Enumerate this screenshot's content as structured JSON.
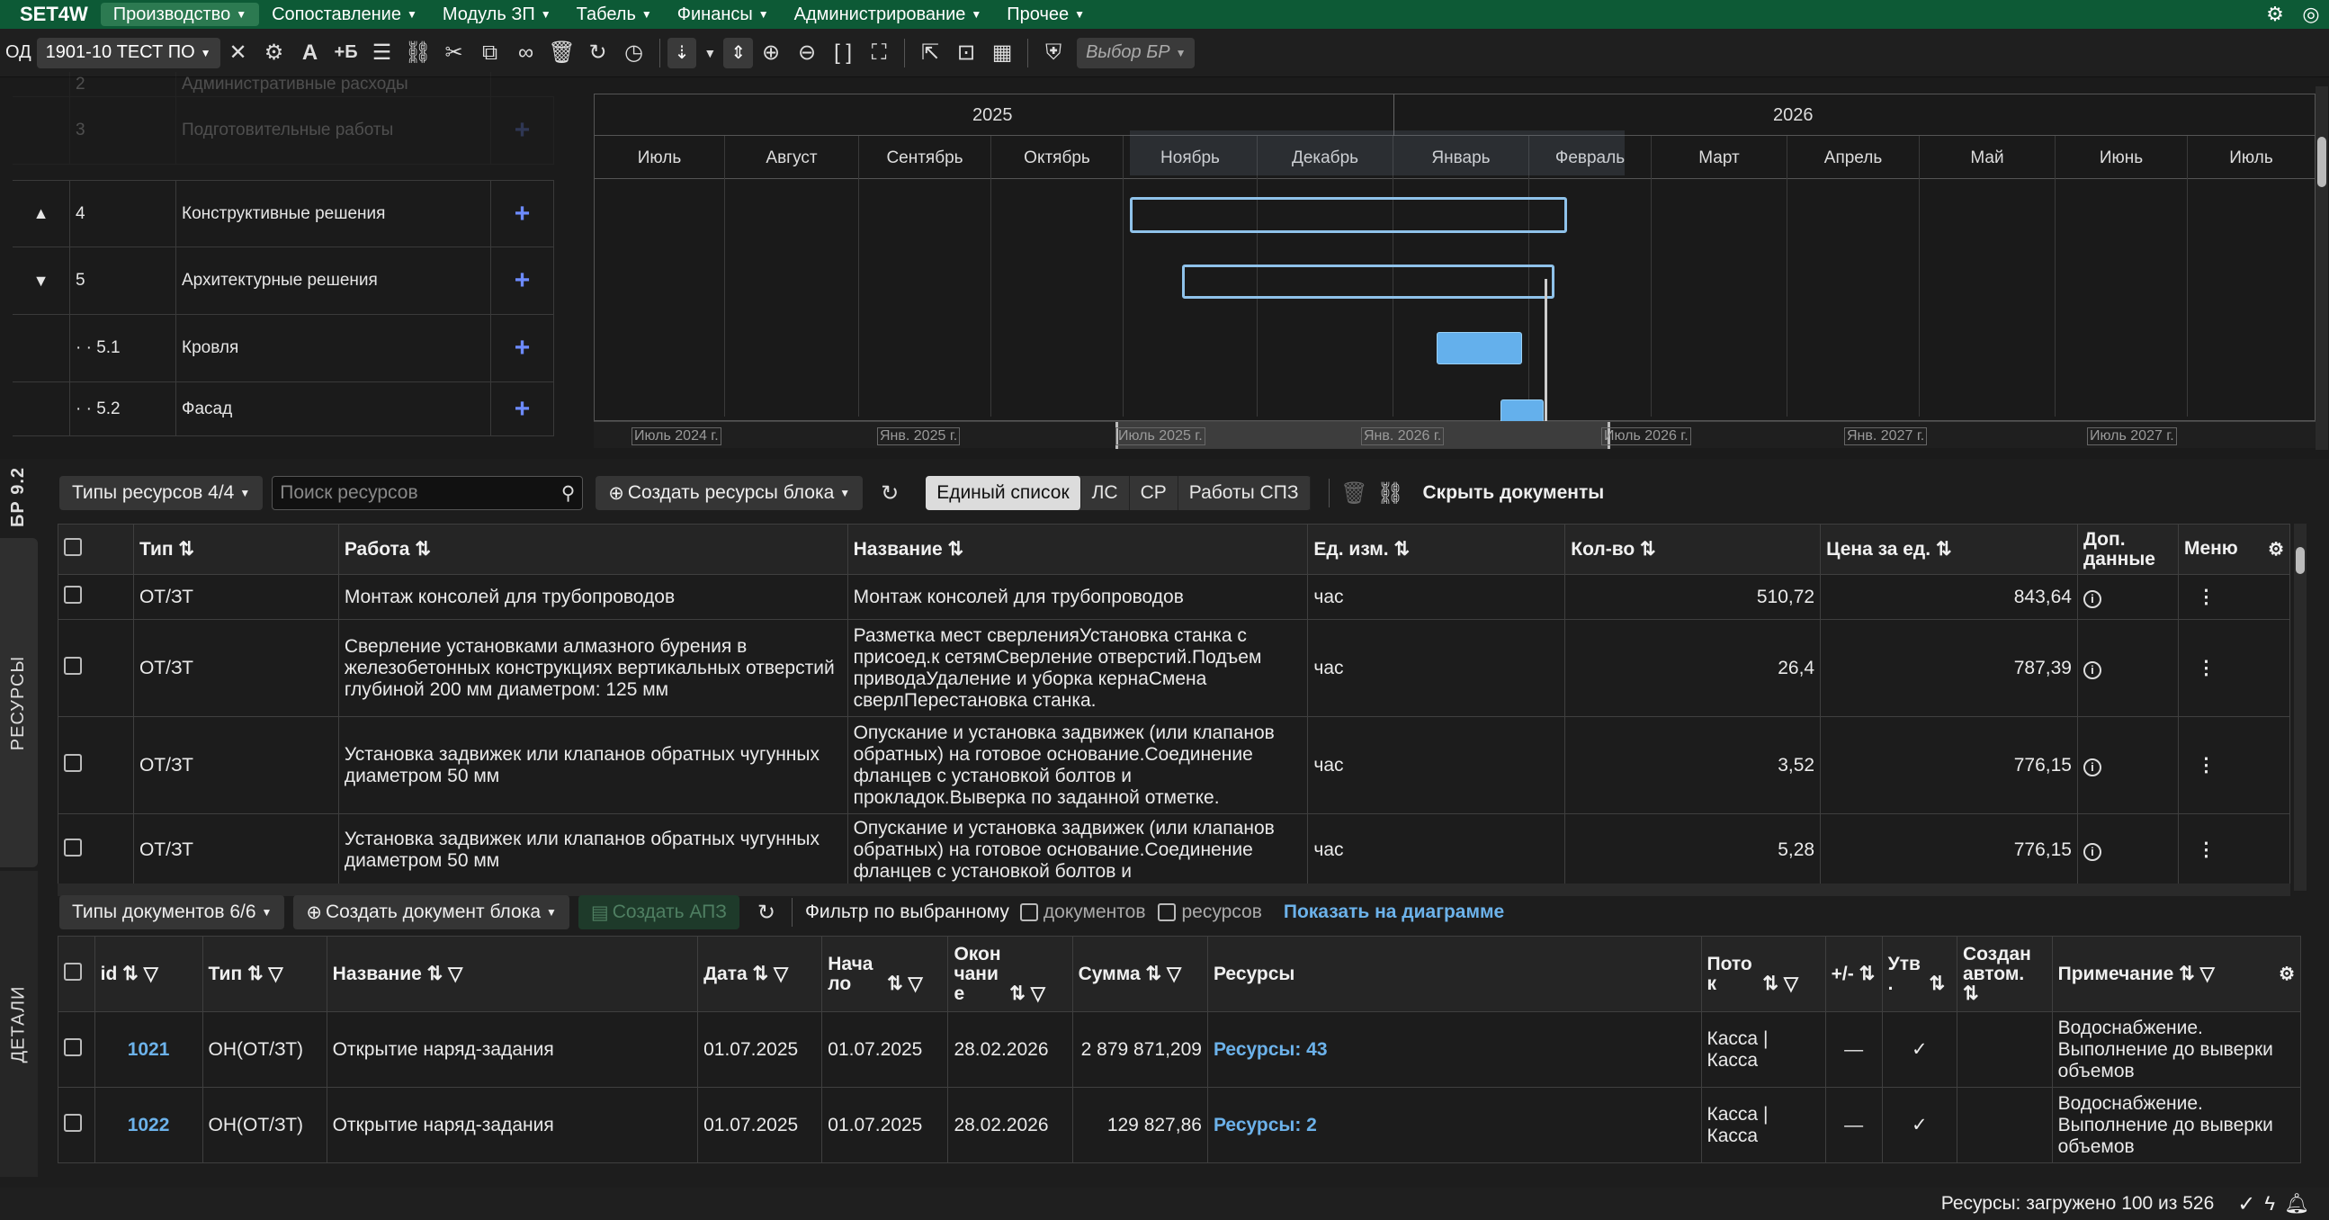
{
  "app": {
    "logo": "SET4W"
  },
  "menu": [
    "Производство",
    "Сопоставление",
    "Модуль ЗП",
    "Табель",
    "Финансы",
    "Администрирование",
    "Прочее"
  ],
  "toolbar": {
    "od_label": "ОД",
    "project": "1901-10 ТЕСТ ПО",
    "select_br": "Выбор БР"
  },
  "gantt": {
    "faded_rows": [
      {
        "num": "2",
        "name": "Административные расходы"
      },
      {
        "num": "3",
        "name": "Подготовительные работы"
      }
    ],
    "rows": [
      {
        "toggle": "▲",
        "num": "4",
        "name": "Конструктивные решения"
      },
      {
        "toggle": "▼",
        "num": "5",
        "name": "Архитектурные решения"
      },
      {
        "toggle": "",
        "num": "· · 5.1",
        "name": "Кровля"
      },
      {
        "toggle": "",
        "num": "· · 5.2",
        "name": "Фасад"
      }
    ],
    "years": [
      "2025",
      "2026"
    ],
    "months": [
      "Июль",
      "Август",
      "Сентябрь",
      "Октябрь",
      "Ноябрь",
      "Декабрь",
      "Январь",
      "Февраль",
      "Март",
      "Апрель",
      "Май",
      "Июнь",
      "Июль"
    ],
    "navigator_labels": [
      "Июль 2024 г.",
      "Янв. 2025 г.",
      "Июль 2025 г.",
      "Янв. 2026 г.",
      "Июль 2026 г.",
      "Янв. 2027 г.",
      "Июль 2027 г."
    ]
  },
  "side_tabs": {
    "br": "БР 9.2",
    "resources": "РЕСУРСЫ",
    "details": "ДЕТАЛИ"
  },
  "resources": {
    "types_btn": "Типы ресурсов 4/4",
    "search_placeholder": "Поиск ресурсов",
    "create_btn": "Создать ресурсы блока",
    "views": [
      "Единый список",
      "ЛС",
      "СР",
      "Работы СПЗ"
    ],
    "hide_docs": "Скрыть документы",
    "headers": {
      "type": "Тип",
      "work": "Работа",
      "name": "Название",
      "unit": "Ед. изм.",
      "qty": "Кол-во",
      "price": "Цена за ед.",
      "extra": "Доп. данные",
      "menu": "Меню"
    },
    "rows": [
      {
        "type": "ОТ/ЗТ",
        "work": "Монтаж консолей для трубопроводов",
        "name": "Монтаж консолей для трубопроводов",
        "unit": "час",
        "qty": "510,72",
        "price": "843,64"
      },
      {
        "type": "ОТ/ЗТ",
        "work": "Сверление установками алмазного бурения в железобетонных конструкциях вертикальных отверстий глубиной 200 мм диаметром: 125 мм",
        "name": "Разметка мест сверленияУстановка станка с присоед.к сетямСверление отверстий.Подъем приводаУдаление и уборка кернаСмена сверлПерестановка станка.",
        "unit": "час",
        "qty": "26,4",
        "price": "787,39"
      },
      {
        "type": "ОТ/ЗТ",
        "work": "Установка задвижек или клапанов обратных чугунных диаметром 50 мм",
        "name": "Опускание и установка задвижек (или клапанов обратных) на готовое основание.Соединение фланцев с установкой болтов и прокладок.Выверка по заданной отметке.",
        "unit": "час",
        "qty": "3,52",
        "price": "776,15"
      },
      {
        "type": "ОТ/ЗТ",
        "work": "Установка задвижек или клапанов обратных чугунных диаметром 50 мм",
        "name": "Опускание и установка задвижек (или клапанов обратных) на готовое основание.Соединение фланцев с установкой болтов и",
        "unit": "час",
        "qty": "5,28",
        "price": "776,15"
      }
    ]
  },
  "documents": {
    "types_btn": "Типы документов 6/6",
    "create_btn": "Создать документ блока",
    "create_apz": "Создать АПЗ",
    "filter_label": "Фильтр по выбранному",
    "filter_docs": "документов",
    "filter_res": "ресурсов",
    "show_on_chart": "Показать на диаграмме",
    "headers": {
      "id": "id",
      "type": "Тип",
      "name": "Название",
      "date": "Дата",
      "start": "Нача ло",
      "end": "Окон чани е",
      "sum": "Сумма",
      "resources": "Ресурсы",
      "flow": "Пото к",
      "diff": "+/-",
      "approved": "Утв .",
      "auto": "Создан автом.",
      "note": "Примечание"
    },
    "rows": [
      {
        "id": "1021",
        "type": "ОН(ОТ/ЗТ)",
        "name": "Открытие наряд-задания",
        "date": "01.07.2025",
        "start": "01.07.2025",
        "end": "28.02.2026",
        "sum": "2 879 871,209",
        "resources": "Ресурсы: 43",
        "flow": "Касса | Касса",
        "diff": "—",
        "approved": "✓",
        "note": "Водоснабжение. Выполнение до выверки объемов"
      },
      {
        "id": "1022",
        "type": "ОН(ОТ/ЗТ)",
        "name": "Открытие наряд-задания",
        "date": "01.07.2025",
        "start": "01.07.2025",
        "end": "28.02.2026",
        "sum": "129 827,86",
        "resources": "Ресурсы: 2",
        "flow": "Касса | Касса",
        "diff": "—",
        "approved": "✓",
        "note": "Водоснабжение. Выполнение до выверки объемов"
      }
    ]
  },
  "status": {
    "text": "Ресурсы: загружено 100 из 526"
  }
}
